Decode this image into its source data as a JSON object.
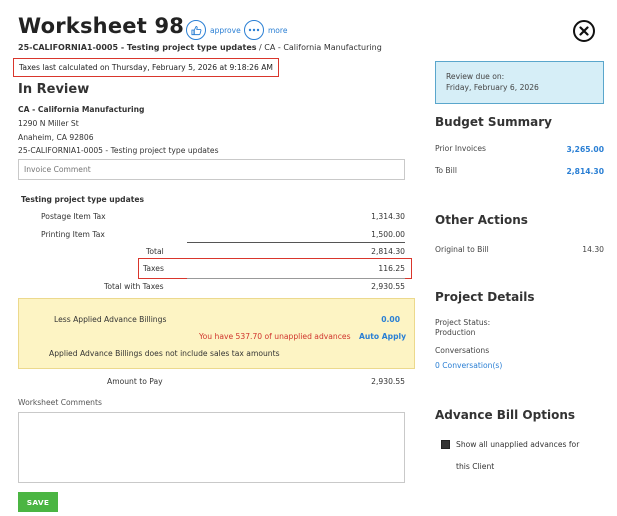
{
  "header": {
    "title": "Worksheet 98",
    "approve_label": "approve",
    "more_label": "more",
    "project_code": "25-CALIFORNIA1-0005 - Testing project type updates",
    "client_ref": " / CA - California Manufacturing",
    "calc_notice": "Taxes last calculated on Thursday, February 5, 2026 at 9:18:26 AM"
  },
  "review": {
    "status_title": "In Review",
    "client_name": "CA - California Manufacturing",
    "address1": "1290 N Miller St",
    "address2": "Anaheim, CA 92806",
    "project_line": "25-CALIFORNIA1-0005 - Testing project type updates",
    "comment_placeholder": "Invoice Comment"
  },
  "invoice": {
    "section_title": "Testing project type updates",
    "items": [
      {
        "label": "Postage Item Tax",
        "amount": "1,314.30"
      },
      {
        "label": "Printing Item Tax",
        "amount": "1,500.00"
      }
    ],
    "total_label": "Total",
    "total_value": "2,814.30",
    "taxes_label": "Taxes",
    "taxes_value": "116.25",
    "total_with_taxes_label": "Total with Taxes",
    "total_with_taxes_value": "2,930.55"
  },
  "advance": {
    "label": "Less Applied Advance Billings",
    "value": "0.00",
    "unapplied_notice": "You have 537.70 of unapplied advances",
    "auto_apply_label": "Auto Apply",
    "note": "Applied Advance Billings does not include sales tax amounts"
  },
  "amount_to_pay": {
    "label": "Amount to Pay",
    "value": "2,930.55"
  },
  "worksheet_comments": {
    "label": "Worksheet Comments",
    "value": ""
  },
  "save_label": "SAVE",
  "sidebar": {
    "review_due_label": "Review due on:",
    "review_due_date": "Friday, February 6, 2026",
    "budget_title": "Budget Summary",
    "prior_invoices_label": "Prior Invoices",
    "prior_invoices_value": "3,265.00",
    "to_bill_label": "To Bill",
    "to_bill_value": "2,814.30",
    "other_actions_title": "Other Actions",
    "original_to_bill_label": "Original to Bill",
    "original_to_bill_value": "14.30",
    "project_details_title": "Project Details",
    "project_status_label": "Project Status:",
    "project_status_value": "Production",
    "conversations_label": "Conversations",
    "conversations_link": "0 Conversation(s)",
    "advance_options_title": "Advance Bill Options",
    "show_unapplied_label_1": "Show all unapplied advances for",
    "show_unapplied_label_2": "this Client",
    "show_unapplied_checked": true
  },
  "colors": {
    "accent": "#2a7fd4",
    "highlight_border": "#d9362c",
    "advance_bg": "#fdf4c4",
    "review_bg": "#d6eef7",
    "save_bg": "#4bb543"
  }
}
